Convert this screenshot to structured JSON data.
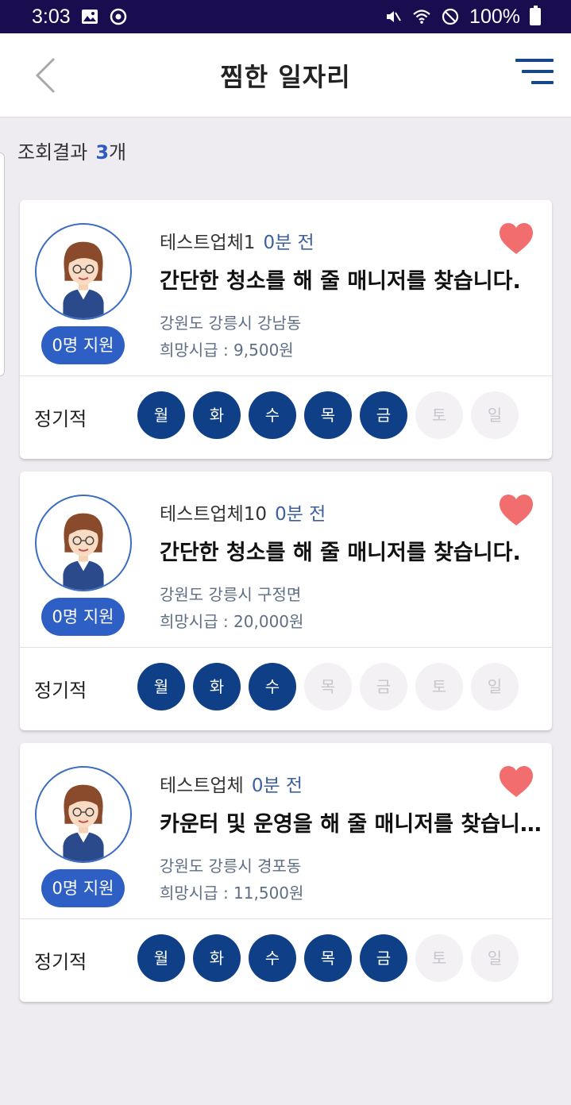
{
  "status_bar": {
    "time": "3:03",
    "battery": "100%"
  },
  "header": {
    "title": "찜한 일자리"
  },
  "result": {
    "label": "조회결과",
    "count": "3",
    "unit": "개"
  },
  "colors": {
    "accent": "#2e5fc4",
    "day_active": "#0f3f86",
    "heart": "#f26d6d",
    "status_bar": "#1a0d4f"
  },
  "jobs": [
    {
      "company": "테스트업체1",
      "time": "0분 전",
      "title": "간단한 청소를 해 줄 매니저를 찾습니다.",
      "location": "강원도 강릉시 강남동",
      "wage": "희망시급 : 9,500원",
      "applicants": "0명 지원",
      "schedule": "정기적",
      "days": [
        {
          "label": "월",
          "active": true
        },
        {
          "label": "화",
          "active": true
        },
        {
          "label": "수",
          "active": true
        },
        {
          "label": "목",
          "active": true
        },
        {
          "label": "금",
          "active": true
        },
        {
          "label": "토",
          "active": false
        },
        {
          "label": "일",
          "active": false
        }
      ]
    },
    {
      "company": "테스트업체10",
      "time": "0분 전",
      "title": "간단한 청소를 해 줄 매니저를 찾습니다.",
      "location": "강원도 강릉시 구정면",
      "wage": "희망시급 : 20,000원",
      "applicants": "0명 지원",
      "schedule": "정기적",
      "days": [
        {
          "label": "월",
          "active": true
        },
        {
          "label": "화",
          "active": true
        },
        {
          "label": "수",
          "active": true
        },
        {
          "label": "목",
          "active": false
        },
        {
          "label": "금",
          "active": false
        },
        {
          "label": "토",
          "active": false
        },
        {
          "label": "일",
          "active": false
        }
      ]
    },
    {
      "company": "테스트업체",
      "time": "0분 전",
      "title": "카운터 및 운영을 해 줄 매니저를 찾습니다.",
      "location": "강원도 강릉시 경포동",
      "wage": "희망시급 : 11,500원",
      "applicants": "0명 지원",
      "schedule": "정기적",
      "days": [
        {
          "label": "월",
          "active": true
        },
        {
          "label": "화",
          "active": true
        },
        {
          "label": "수",
          "active": true
        },
        {
          "label": "목",
          "active": true
        },
        {
          "label": "금",
          "active": true
        },
        {
          "label": "토",
          "active": false
        },
        {
          "label": "일",
          "active": false
        }
      ]
    }
  ]
}
